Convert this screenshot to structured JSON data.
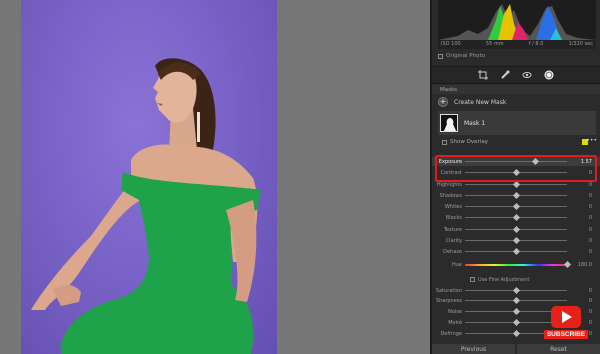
{
  "histogram": {
    "info_left": "ISO 100",
    "info_mid": "55 mm",
    "info_right": "f / 8.0",
    "info_far": "1/320 sec",
    "original_photo_label": "Original Photo"
  },
  "tools": [
    "edit-icon",
    "crop-icon",
    "heal-icon",
    "redeye-icon",
    "mask-icon"
  ],
  "masks": {
    "header": "Masks",
    "create_label": "Create New Mask",
    "mask_name": "Mask 1",
    "show_overlay_label": "Show Overlay",
    "overlay_color": "#d9e000"
  },
  "sliders": [
    {
      "label": "Exposure",
      "value": "1.57",
      "level": 0.69,
      "active": true
    },
    {
      "label": "Contrast",
      "value": "0",
      "level": 0.5
    },
    {
      "label": "Highlights",
      "value": "0",
      "level": 0.5
    },
    {
      "label": "Shadows",
      "value": "0",
      "level": 0.5
    },
    {
      "label": "Whites",
      "value": "0",
      "level": 0.5
    },
    {
      "label": "Blacks",
      "value": "0",
      "level": 0.5
    },
    {
      "label": "Texture",
      "value": "0",
      "level": 0.5
    },
    {
      "label": "Clarity",
      "value": "0",
      "level": 0.5
    },
    {
      "label": "Dehaze",
      "value": "0",
      "level": 0.5
    },
    {
      "label": "Hue",
      "value": "180.0",
      "level": 1.0,
      "hue": true
    },
    {
      "label": "Saturation",
      "value": "0",
      "level": 0.5
    },
    {
      "label": "Sharpness",
      "value": "0",
      "level": 0.5
    },
    {
      "label": "Noise",
      "value": "0",
      "level": 0.5
    },
    {
      "label": "Moiré",
      "value": "0",
      "level": 0.5
    },
    {
      "label": "Defringe",
      "value": "0",
      "level": 0.5
    }
  ],
  "use_fine_label": "Use Fine Adjustment",
  "buttons": {
    "previous": "Previous",
    "reset": "Reset"
  },
  "badge": {
    "subscribe": "SUBSCRIBE"
  },
  "colors": {
    "highlight": "#e21b1b",
    "backdrop": "#7a63c8",
    "dress": "#1fa34a"
  }
}
